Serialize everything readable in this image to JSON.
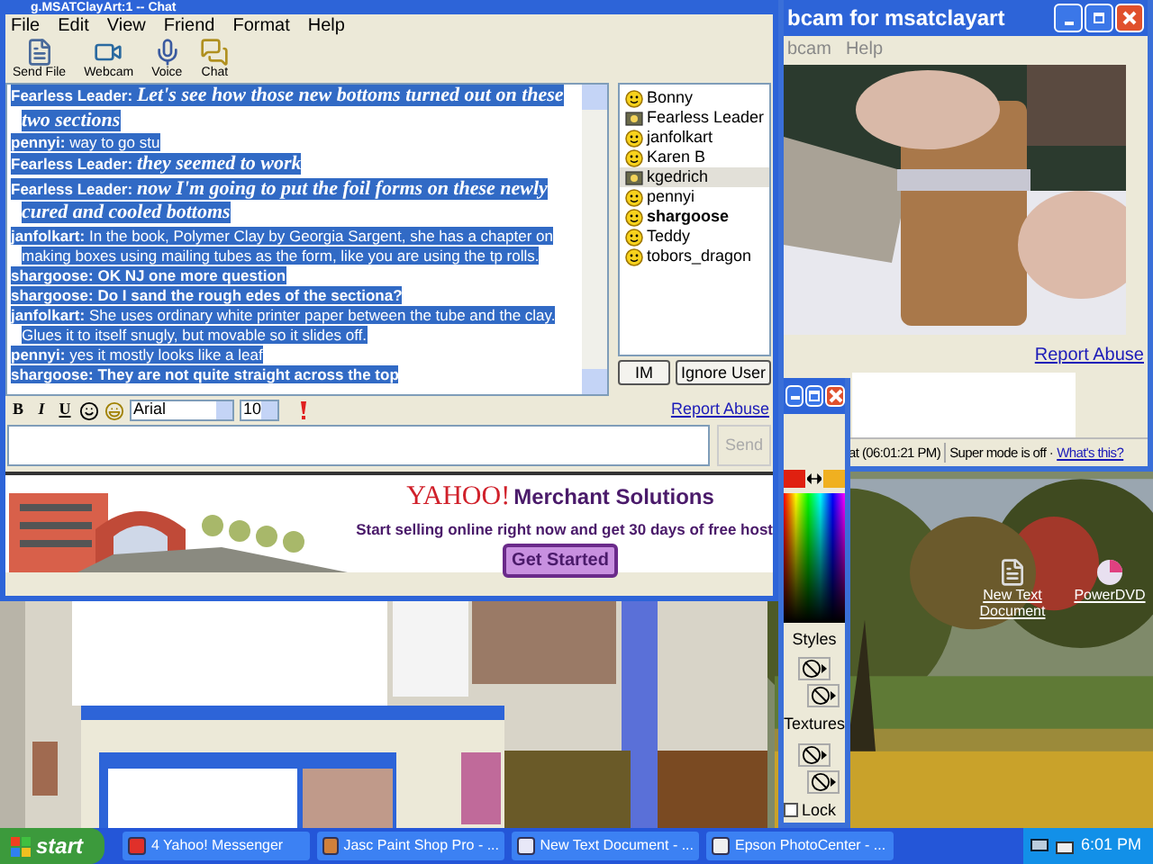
{
  "chat_window": {
    "title": "g.MSATClayArt:1 -- Chat",
    "menu": [
      "File",
      "Edit",
      "View",
      "Friend",
      "Format",
      "Help"
    ],
    "toolbar": [
      {
        "label": "Send File",
        "kind": "file"
      },
      {
        "label": "Webcam",
        "kind": "webcam"
      },
      {
        "label": "Voice",
        "kind": "voice"
      },
      {
        "label": "Chat",
        "kind": "chat"
      }
    ],
    "messages": [
      {
        "sender": "Fearless Leader:",
        "text": "Let's see how those new bottoms turned out on these two sections",
        "kind": "script",
        "selected": true
      },
      {
        "sender": "pennyi:",
        "text": "way to go stu",
        "kind": "plain",
        "selected": true
      },
      {
        "sender": "Fearless Leader:",
        "text": "they seemed to work",
        "kind": "script",
        "selected": true
      },
      {
        "sender": "Fearless Leader:",
        "text": "now I'm going to put the foil forms on these newly cured and cooled bottoms",
        "kind": "script",
        "selected": true
      },
      {
        "sender": "janfolkart:",
        "text": "In the book, Polymer Clay by Georgia Sargent, she has a chapter on making boxes using mailing tubes as the form, like you are using the tp rolls.",
        "kind": "plain",
        "selected": true
      },
      {
        "sender": "shargoose:",
        "text": "OK NJ one more question",
        "kind": "bold",
        "selected": true
      },
      {
        "sender": "shargoose:",
        "text": "Do I sand the rough edes of the sectiona?",
        "kind": "bold",
        "selected": true
      },
      {
        "sender": "janfolkart:",
        "text": "She uses ordinary white printer paper between the tube and the clay. Glues it to itself snugly, but movable so it slides off.",
        "kind": "plain",
        "selected": true
      },
      {
        "sender": "pennyi:",
        "text": "yes it mostly looks like a leaf",
        "kind": "plain",
        "selected": true
      },
      {
        "sender": "shargoose:",
        "text": "They are not quite straight across the top",
        "kind": "bold",
        "selected": true
      }
    ],
    "users": [
      {
        "name": "Bonny",
        "kind": "smiley",
        "bold": false,
        "selected": false
      },
      {
        "name": "Fearless Leader",
        "kind": "webcam",
        "bold": false,
        "selected": false
      },
      {
        "name": "janfolkart",
        "kind": "smiley",
        "bold": false,
        "selected": false
      },
      {
        "name": "Karen B",
        "kind": "smiley",
        "bold": false,
        "selected": false
      },
      {
        "name": "kgedrich",
        "kind": "webcam",
        "bold": false,
        "selected": true
      },
      {
        "name": "pennyi",
        "kind": "smiley",
        "bold": false,
        "selected": false
      },
      {
        "name": "shargoose",
        "kind": "smiley",
        "bold": true,
        "selected": false
      },
      {
        "name": "Teddy",
        "kind": "smiley",
        "bold": false,
        "selected": false
      },
      {
        "name": "tobors_dragon",
        "kind": "smiley",
        "bold": false,
        "selected": false
      }
    ],
    "user_buttons": [
      "IM",
      "Ignore User"
    ],
    "format_bar": {
      "bold": "B",
      "italic": "I",
      "underline": "U",
      "font": "Arial",
      "size": "10",
      "report_link": "Report Abuse"
    },
    "send_button": {
      "label": "Send",
      "disabled": true
    },
    "ad": {
      "brand": "YAHOO!",
      "headline": "Merchant Solutions",
      "text": "Start selling online right now and get 30 days of free host",
      "button": "Get Started"
    }
  },
  "webcam_window": {
    "title": "bcam for msatclayart",
    "menu": [
      "bcam",
      "Help"
    ],
    "report_link": "Report Abuse",
    "status": "at (06:01:21 PM)",
    "mode": "Super mode is off ·",
    "help_link": "What's this?"
  },
  "palette": {
    "styles_label": "Styles",
    "textures_label": "Textures",
    "lock": {
      "label": "Lock",
      "checked": false
    }
  },
  "desktop_icons": [
    {
      "label": "New Text Document",
      "kind": "document"
    },
    {
      "label": "PowerDVD",
      "kind": "disc"
    }
  ],
  "taskbar": {
    "start": "start",
    "buttons": [
      {
        "label": "4 Yahoo! Messenger",
        "kind": "messenger"
      },
      {
        "label": "Jasc Paint Shop Pro - ...",
        "kind": "paint"
      },
      {
        "label": "New Text Document - ...",
        "kind": "notepad"
      },
      {
        "label": "Epson PhotoCenter - ..."
      }
    ],
    "clock": "6:01 PM"
  }
}
